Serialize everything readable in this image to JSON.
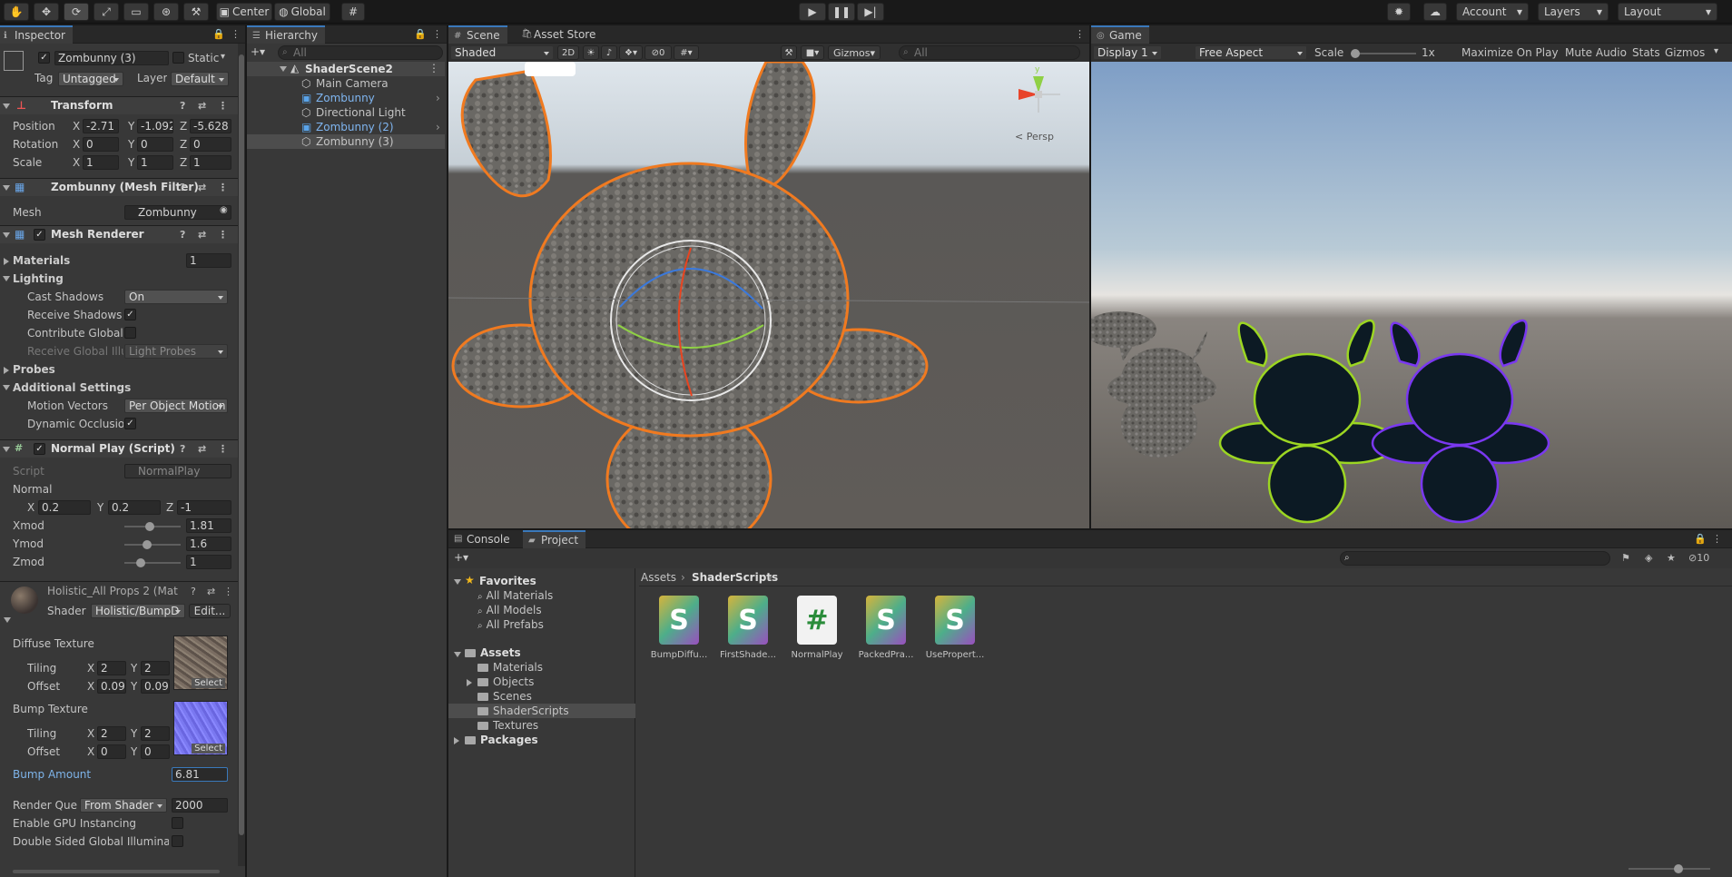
{
  "toolbar": {
    "pivot": "Center",
    "space": "Global",
    "account": "Account",
    "layers": "Layers",
    "layout": "Layout"
  },
  "inspector": {
    "tab": "Inspector",
    "object_name": "Zombunny (3)",
    "static": "Static",
    "tag_label": "Tag",
    "tag_value": "Untagged",
    "layer_label": "Layer",
    "layer_value": "Default",
    "transform": {
      "title": "Transform",
      "position": {
        "label": "Position",
        "x": "-2.71",
        "y": "-1.092",
        "z": "-5.628"
      },
      "rotation": {
        "label": "Rotation",
        "x": "0",
        "y": "0",
        "z": "0"
      },
      "scale": {
        "label": "Scale",
        "x": "1",
        "y": "1",
        "z": "1"
      }
    },
    "mesh_filter": {
      "title": "Zombunny (Mesh Filter)",
      "mesh_label": "Mesh",
      "mesh_value": "Zombunny"
    },
    "mesh_renderer": {
      "title": "Mesh Renderer",
      "materials_label": "Materials",
      "materials_count": "1",
      "lighting_label": "Lighting",
      "cast_shadows_label": "Cast Shadows",
      "cast_shadows_value": "On",
      "receive_shadows_label": "Receive Shadows",
      "contribute_gi_label": "Contribute Global I",
      "receive_gi_label": "Receive Global Illu",
      "receive_gi_value": "Light Probes",
      "probes_label": "Probes",
      "additional_label": "Additional Settings",
      "motion_vectors_label": "Motion Vectors",
      "motion_vectors_value": "Per Object Motion",
      "dynamic_occlusion_label": "Dynamic Occlusio"
    },
    "script": {
      "title": "Normal Play (Script)",
      "script_label": "Script",
      "script_value": "NormalPlay",
      "normal_label": "Normal",
      "nx": "0.2",
      "ny": "0.2",
      "nz": "-1",
      "xmod_label": "Xmod",
      "xmod": "1.81",
      "xmod_frac": 0.45,
      "ymod_label": "Ymod",
      "ymod": "1.6",
      "ymod_frac": 0.38,
      "zmod_label": "Zmod",
      "zmod": "1",
      "zmod_frac": 0.25
    },
    "material": {
      "title": "Holistic_All Props 2 (Mat",
      "shader_label": "Shader",
      "shader_value": "Holistic/BumpD",
      "edit": "Edit...",
      "diffuse_label": "Diffuse Texture",
      "tiling_label": "Tiling",
      "offset_label": "Offset",
      "d_tx": "2",
      "d_ty": "2",
      "d_ox": "0.09",
      "d_oy": "0.09",
      "select": "Select",
      "bump_label": "Bump Texture",
      "b_tx": "2",
      "b_ty": "2",
      "b_ox": "0",
      "b_oy": "0",
      "bump_amount_label": "Bump Amount",
      "bump_amount": "6.81",
      "render_queue_label": "Render Queu",
      "render_queue_mode": "From Shader",
      "render_queue_value": "2000",
      "gpu_instancing_label": "Enable GPU Instancing",
      "double_sided_label": "Double Sided Global Illuminatic"
    }
  },
  "hierarchy": {
    "tab": "Hierarchy",
    "search": "All",
    "scene": "ShaderScene2",
    "items": [
      {
        "label": "Main Camera",
        "prefab": false
      },
      {
        "label": "Zombunny",
        "prefab": true
      },
      {
        "label": "Directional Light",
        "prefab": false
      },
      {
        "label": "Zombunny (2)",
        "prefab": true
      },
      {
        "label": "Zombunny (3)",
        "prefab": false
      }
    ]
  },
  "scene": {
    "tab": "Scene",
    "asset_store_tab": "Asset Store",
    "shading": "Shaded",
    "mode_2d": "2D",
    "hidden_count": "0",
    "gizmos": "Gizmos",
    "search": "All",
    "persp": "< Persp",
    "axis_y": "y"
  },
  "game": {
    "tab": "Game",
    "display": "Display 1",
    "aspect": "Free Aspect",
    "scale_label": "Scale",
    "scale_value": "1x",
    "maximize": "Maximize On Play",
    "mute": "Mute Audio",
    "stats": "Stats",
    "gizmos": "Gizmos"
  },
  "bottom": {
    "console_tab": "Console",
    "project_tab": "Project",
    "hidden_count": "10",
    "tree": {
      "favorites": "Favorites",
      "fav_items": [
        "All Materials",
        "All Models",
        "All Prefabs"
      ],
      "assets": "Assets",
      "folders": [
        "Materials",
        "Objects",
        "Scenes",
        "ShaderScripts",
        "Textures"
      ],
      "packages": "Packages"
    },
    "breadcrumb": {
      "root": "Assets",
      "current": "ShaderScripts"
    },
    "assets": [
      {
        "name": "BumpDiffu...",
        "icon": "S"
      },
      {
        "name": "FirstShade...",
        "icon": "S"
      },
      {
        "name": "NormalPlay",
        "icon": "#"
      },
      {
        "name": "PackedPra...",
        "icon": "S"
      },
      {
        "name": "UsePropert...",
        "icon": "S"
      }
    ]
  }
}
